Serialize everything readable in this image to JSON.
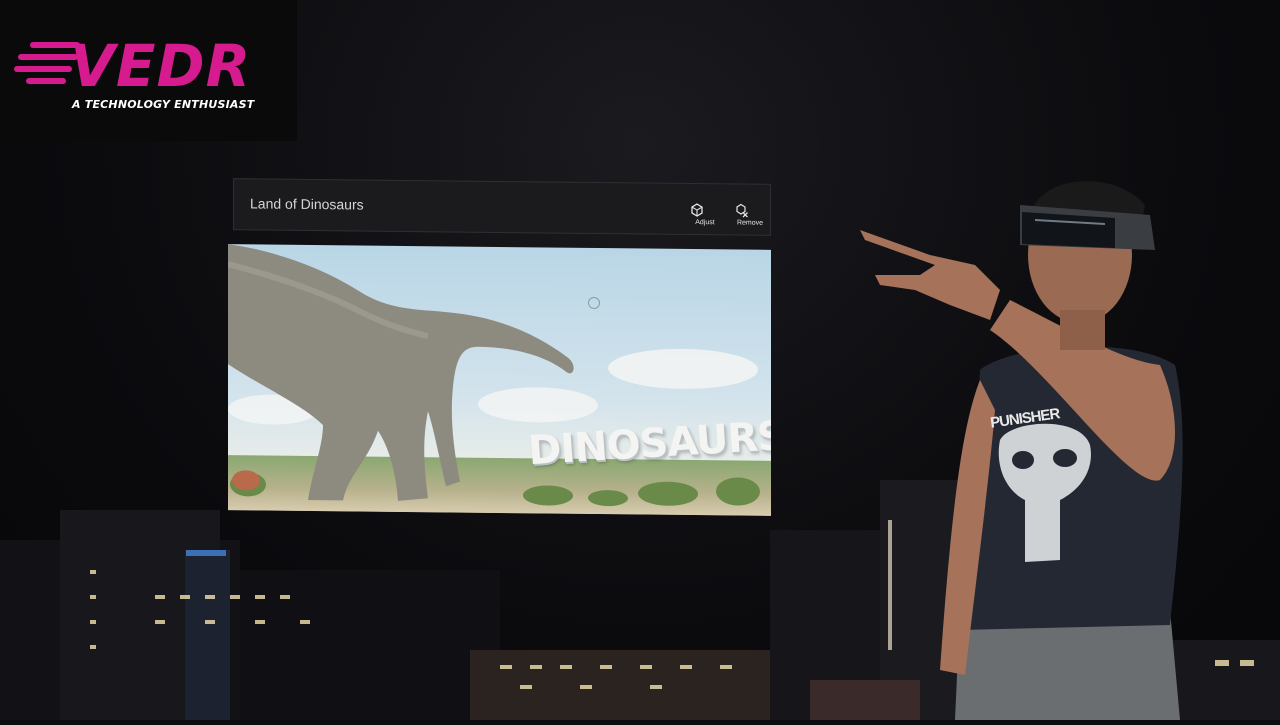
{
  "logo": {
    "brand": "VEDR",
    "tagline": "A TECHNOLOGY ENTHUSIAST",
    "color": "#d51b8d"
  },
  "window": {
    "title": "Land of Dinosaurs",
    "buttons": [
      {
        "label": "Adjust",
        "icon": "adjust-icon"
      },
      {
        "label": "Remove",
        "icon": "remove-icon"
      }
    ],
    "content_title": "DINOSAURS"
  },
  "person": {
    "shirt_text": "PUNISHER"
  }
}
